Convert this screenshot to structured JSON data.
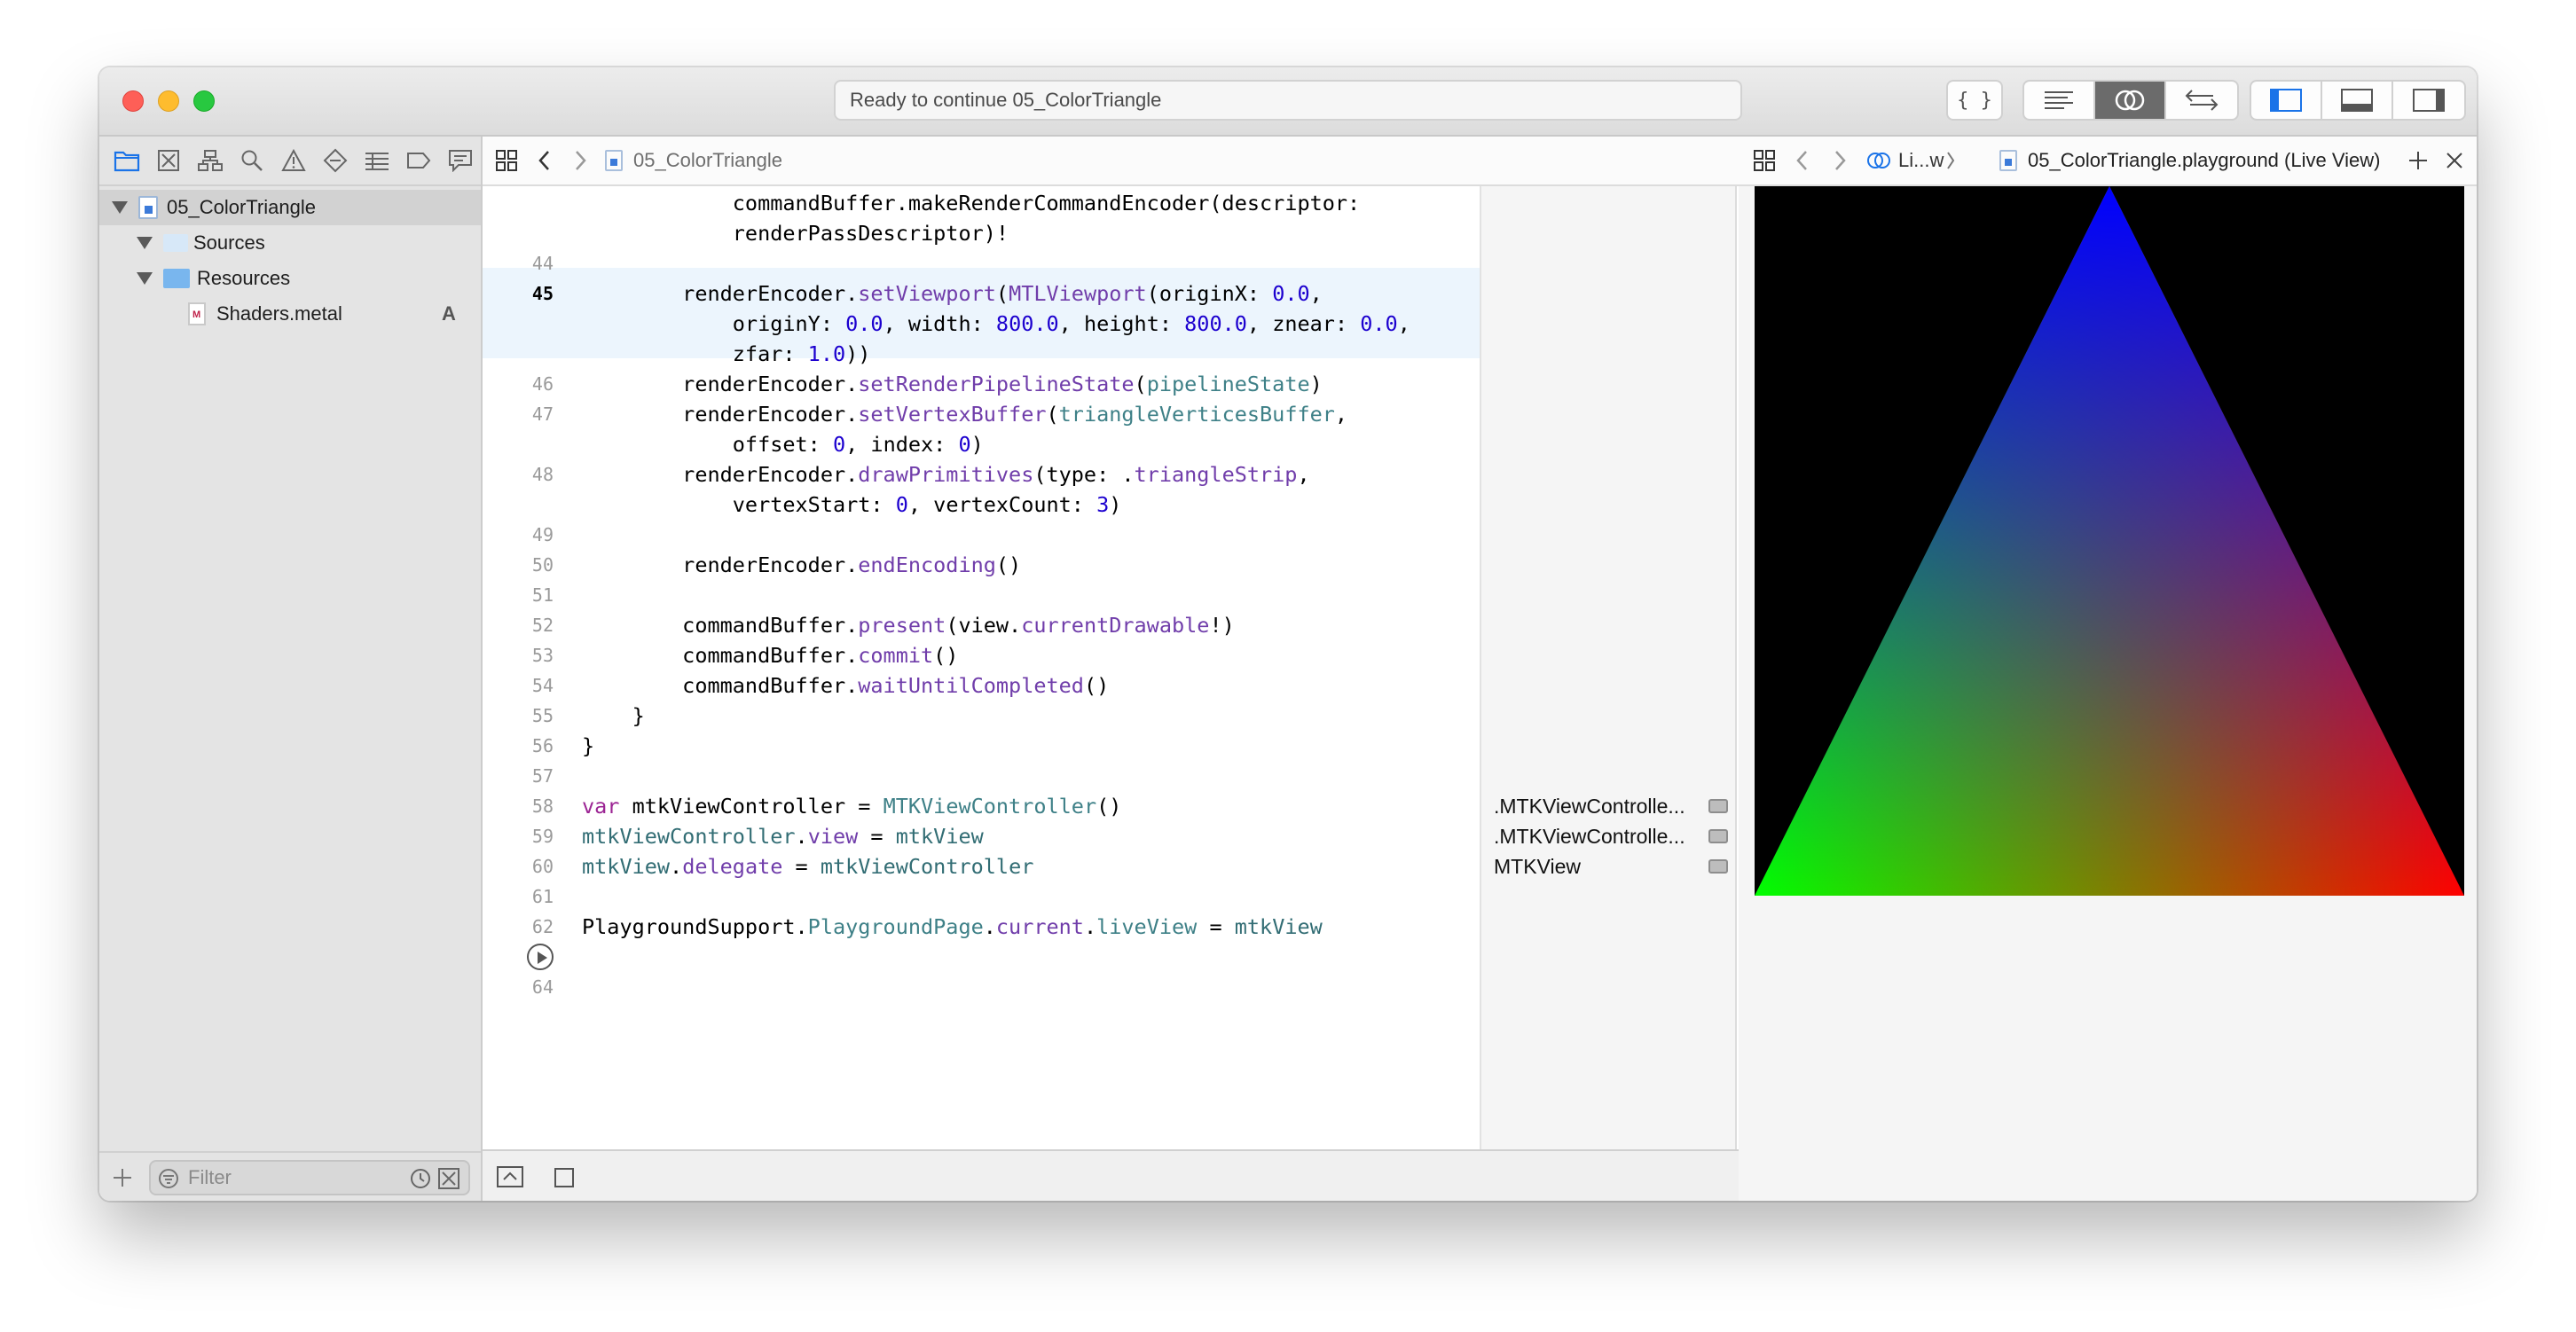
{
  "window": {
    "status": "Ready to continue 05_ColorTriangle"
  },
  "navigator": {
    "project": "05_ColorTriangle",
    "items": [
      {
        "label": "Sources"
      },
      {
        "label": "Resources"
      },
      {
        "label": "Shaders.metal",
        "badge": "A"
      }
    ],
    "filter_placeholder": "Filter"
  },
  "editor": {
    "breadcrumb": "05_ColorTriangle",
    "lines": [
      {
        "n": "",
        "tokens": [
          [
            "",
            "            commandBuffer.makeRenderCommandEncoder(descriptor:"
          ]
        ]
      },
      {
        "n": "",
        "tokens": [
          [
            "",
            "            renderPassDescriptor)!"
          ]
        ]
      },
      {
        "n": "44",
        "tokens": [
          [
            "",
            ""
          ]
        ]
      },
      {
        "n": "45",
        "tokens": [
          [
            "",
            "        renderEncoder."
          ],
          [
            "ty2",
            "setViewport"
          ],
          [
            "",
            "("
          ],
          [
            "ty2",
            "MTLViewport"
          ],
          [
            "",
            "(originX: "
          ],
          [
            "num",
            "0.0"
          ],
          [
            "",
            ","
          ]
        ]
      },
      {
        "n": "",
        "tokens": [
          [
            "",
            "            originY: "
          ],
          [
            "num",
            "0.0"
          ],
          [
            "",
            ", width: "
          ],
          [
            "num",
            "800.0"
          ],
          [
            "",
            ", height: "
          ],
          [
            "num",
            "800.0"
          ],
          [
            "",
            ", znear: "
          ],
          [
            "num",
            "0.0"
          ],
          [
            "",
            ","
          ]
        ]
      },
      {
        "n": "",
        "tokens": [
          [
            "",
            "            zfar: "
          ],
          [
            "num",
            "1.0"
          ],
          [
            "",
            "))"
          ]
        ]
      },
      {
        "n": "46",
        "tokens": [
          [
            "",
            "        renderEncoder."
          ],
          [
            "ty2",
            "setRenderPipelineState"
          ],
          [
            "",
            "("
          ],
          [
            "ty",
            "pipelineState"
          ],
          [
            "",
            ")"
          ]
        ]
      },
      {
        "n": "47",
        "tokens": [
          [
            "",
            "        renderEncoder."
          ],
          [
            "ty2",
            "setVertexBuffer"
          ],
          [
            "",
            "("
          ],
          [
            "ty",
            "triangleVerticesBuffer"
          ],
          [
            "",
            ","
          ]
        ]
      },
      {
        "n": "",
        "tokens": [
          [
            "",
            "            offset: "
          ],
          [
            "num",
            "0"
          ],
          [
            "",
            ", index: "
          ],
          [
            "num",
            "0"
          ],
          [
            "",
            ")"
          ]
        ]
      },
      {
        "n": "48",
        "tokens": [
          [
            "",
            "        renderEncoder."
          ],
          [
            "ty2",
            "drawPrimitives"
          ],
          [
            "",
            "(type: ."
          ],
          [
            "ty2",
            "triangleStrip"
          ],
          [
            "",
            ","
          ]
        ]
      },
      {
        "n": "",
        "tokens": [
          [
            "",
            "            vertexStart: "
          ],
          [
            "num",
            "0"
          ],
          [
            "",
            ", vertexCount: "
          ],
          [
            "num",
            "3"
          ],
          [
            "",
            ")"
          ]
        ]
      },
      {
        "n": "49",
        "tokens": [
          [
            "",
            ""
          ]
        ]
      },
      {
        "n": "50",
        "tokens": [
          [
            "",
            "        renderEncoder."
          ],
          [
            "ty2",
            "endEncoding"
          ],
          [
            "",
            "()"
          ]
        ]
      },
      {
        "n": "51",
        "tokens": [
          [
            "",
            ""
          ]
        ]
      },
      {
        "n": "52",
        "tokens": [
          [
            "",
            "        commandBuffer."
          ],
          [
            "ty2",
            "present"
          ],
          [
            "",
            "(view."
          ],
          [
            "ty2",
            "currentDrawable"
          ],
          [
            "",
            "!)"
          ]
        ]
      },
      {
        "n": "53",
        "tokens": [
          [
            "",
            "        commandBuffer."
          ],
          [
            "ty2",
            "commit"
          ],
          [
            "",
            "()"
          ]
        ]
      },
      {
        "n": "54",
        "tokens": [
          [
            "",
            "        commandBuffer."
          ],
          [
            "ty2",
            "waitUntilCompleted"
          ],
          [
            "",
            "()"
          ]
        ]
      },
      {
        "n": "55",
        "tokens": [
          [
            "",
            "    }"
          ]
        ]
      },
      {
        "n": "56",
        "tokens": [
          [
            "",
            "}"
          ]
        ]
      },
      {
        "n": "57",
        "tokens": [
          [
            "",
            ""
          ]
        ]
      },
      {
        "n": "58",
        "tokens": [
          [
            "kw",
            "var"
          ],
          [
            "",
            " mtkViewController = "
          ],
          [
            "ty",
            "MTKViewController"
          ],
          [
            "",
            "()"
          ]
        ]
      },
      {
        "n": "59",
        "tokens": [
          [
            "prop",
            "mtkViewController"
          ],
          [
            "",
            "."
          ],
          [
            "ty2",
            "view"
          ],
          [
            "",
            " = "
          ],
          [
            "prop",
            "mtkView"
          ]
        ]
      },
      {
        "n": "60",
        "tokens": [
          [
            "prop",
            "mtkView"
          ],
          [
            "",
            "."
          ],
          [
            "ty2",
            "delegate"
          ],
          [
            "",
            " = "
          ],
          [
            "prop",
            "mtkViewController"
          ]
        ]
      },
      {
        "n": "61",
        "tokens": [
          [
            "",
            ""
          ]
        ]
      },
      {
        "n": "62",
        "tokens": [
          [
            "",
            "PlaygroundSupport."
          ],
          [
            "ty",
            "PlaygroundPage"
          ],
          [
            "",
            "."
          ],
          [
            "ty2",
            "current"
          ],
          [
            "",
            "."
          ],
          [
            "ty",
            "liveView"
          ],
          [
            "",
            " = "
          ],
          [
            "prop",
            "mtkView"
          ]
        ]
      },
      {
        "n": "",
        "tokens": [
          [
            "",
            ""
          ]
        ]
      },
      {
        "n": "64",
        "tokens": [
          [
            "",
            ""
          ]
        ]
      }
    ],
    "results": [
      ".MTKViewControlle...",
      ".MTKViewControlle...",
      "MTKView"
    ]
  },
  "liveview": {
    "crumb_short": "Li...w",
    "crumb_title": "05_ColorTriangle.playground (Live View)",
    "triangle_colors": {
      "top": "#0000ff",
      "bottom_left": "#00ff00",
      "bottom_right": "#ff0000"
    }
  }
}
